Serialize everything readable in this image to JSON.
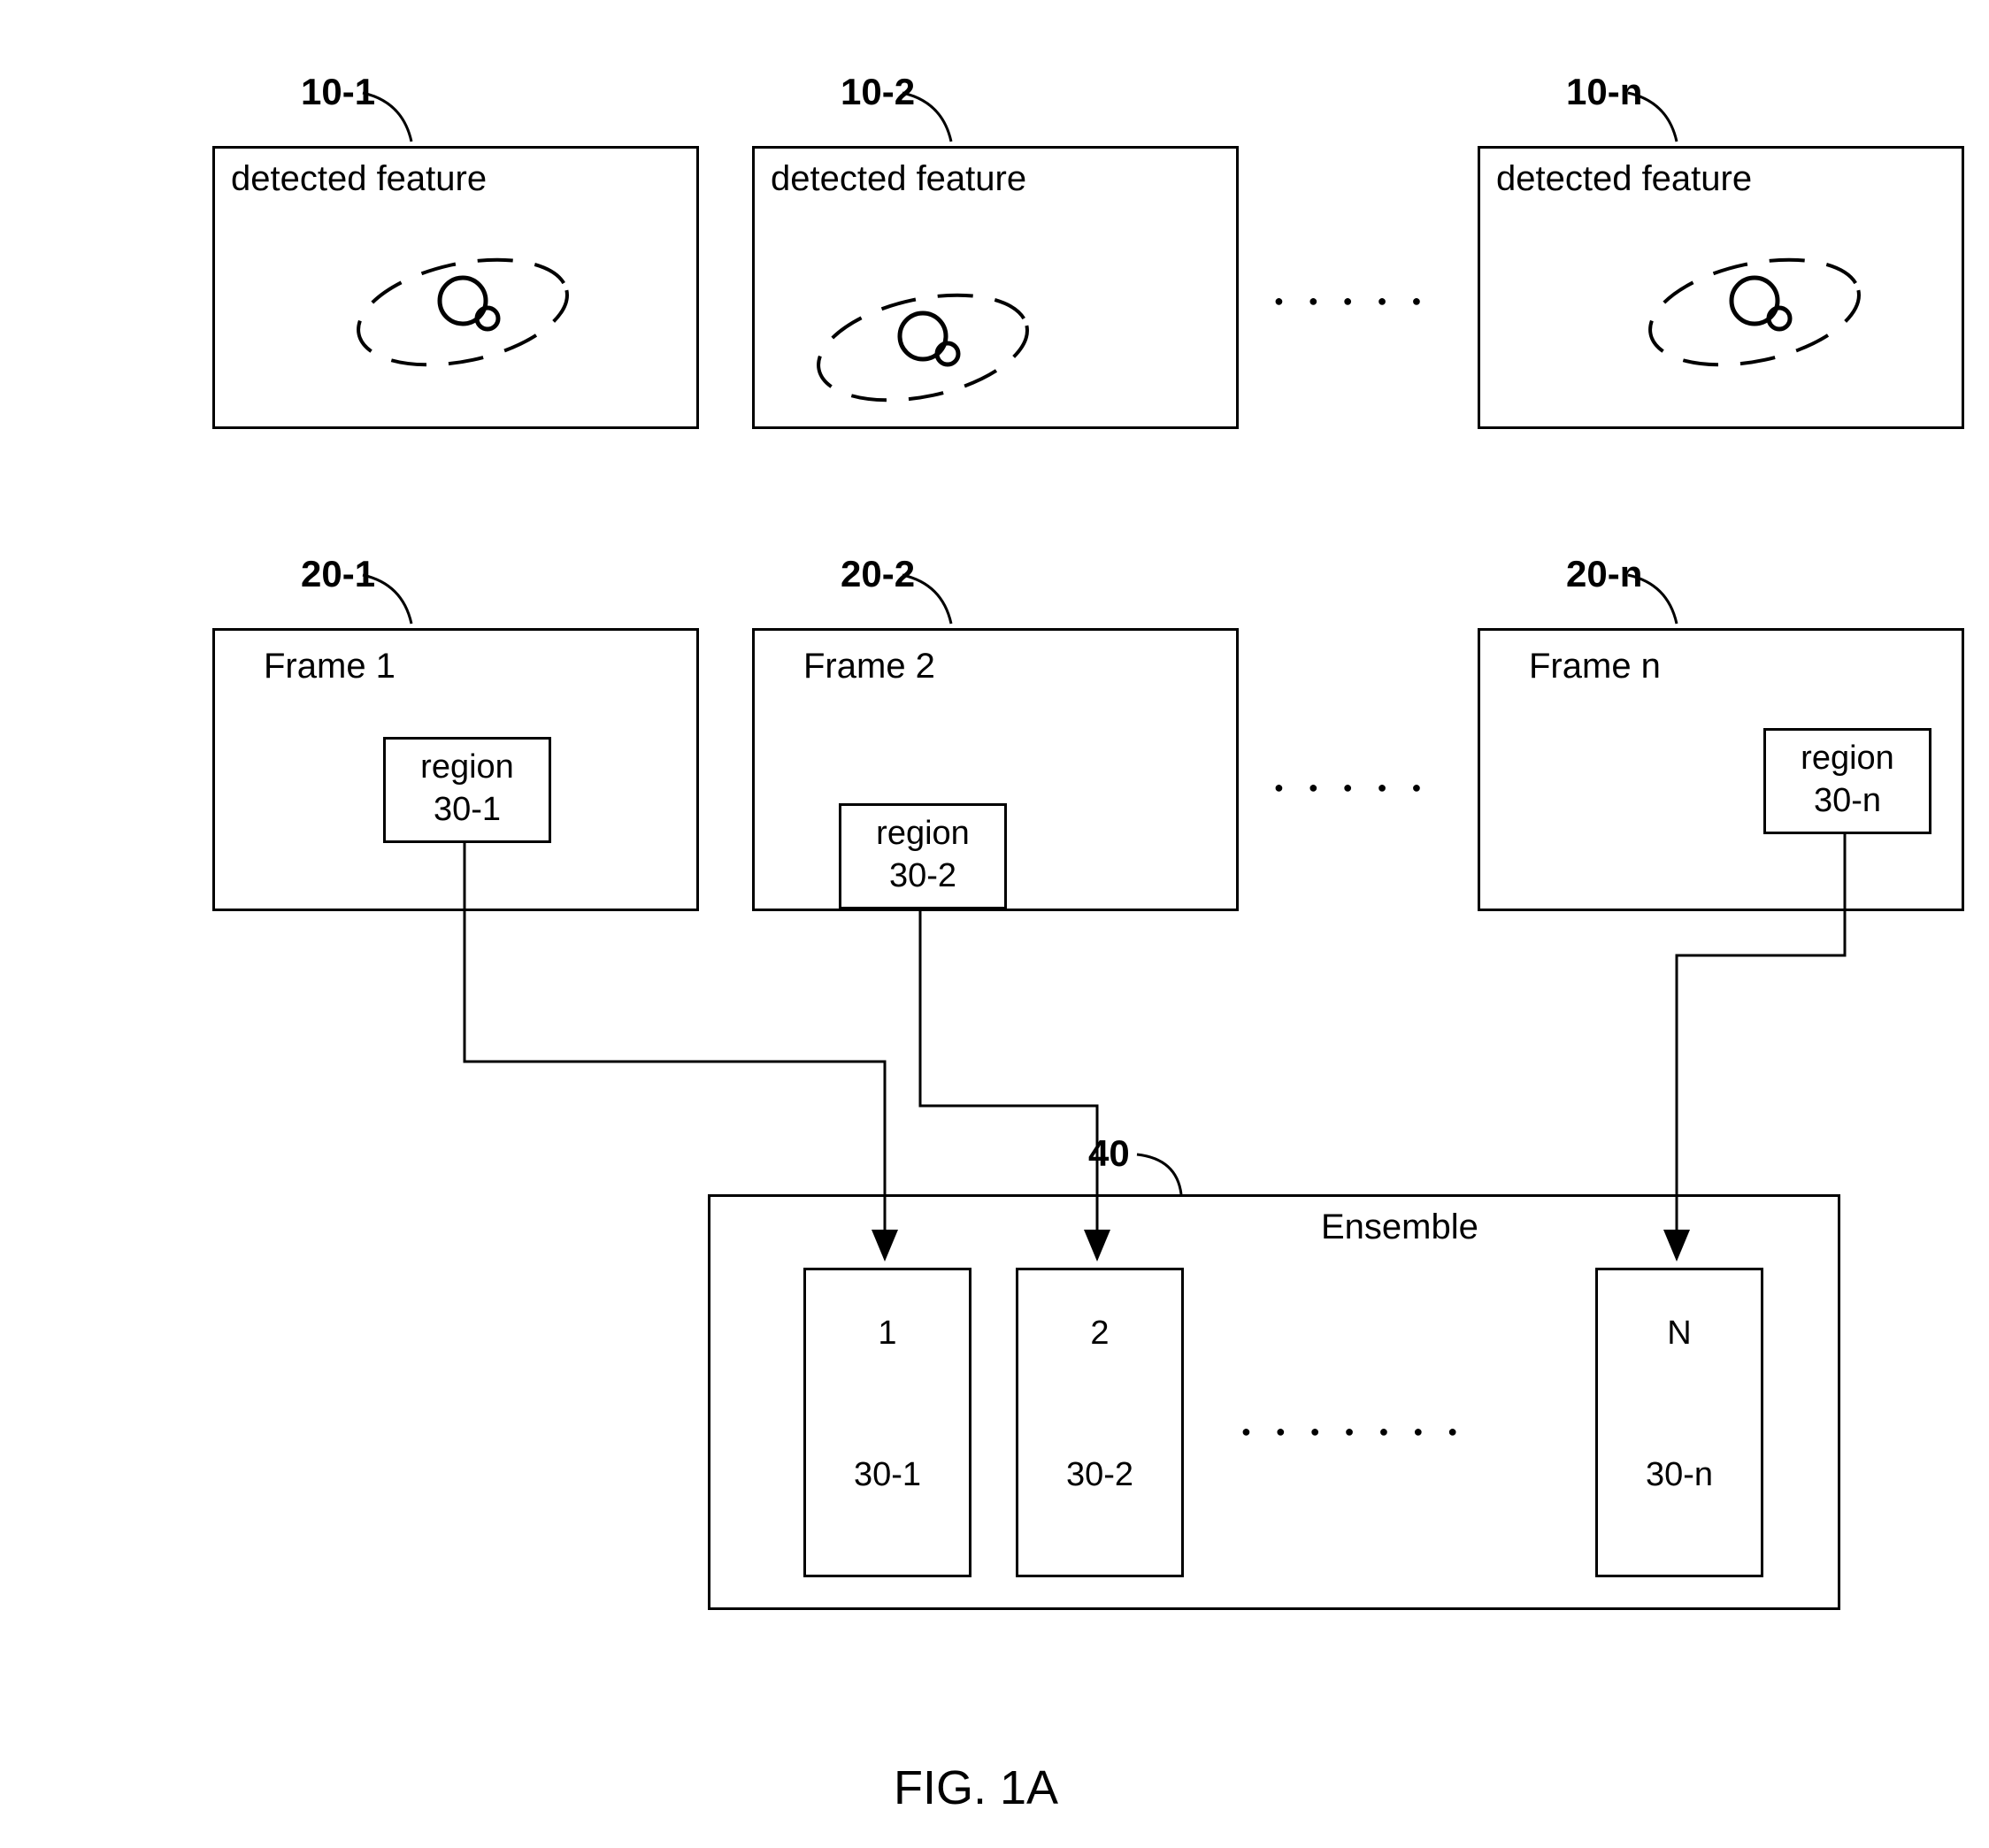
{
  "row1": {
    "ref1": "10-1",
    "ref2": "10-2",
    "refn": "10-n",
    "label": "detected feature"
  },
  "row2": {
    "ref1": "20-1",
    "ref2": "20-2",
    "refn": "20-n",
    "frame1": "Frame 1",
    "frame2": "Frame 2",
    "framen": "Frame n",
    "region": "region",
    "region1": "30-1",
    "region2": "30-2",
    "regionn": "30-n"
  },
  "ensemble": {
    "ref": "40",
    "label": "Ensemble",
    "slot1_top": "1",
    "slot1_bot": "30-1",
    "slot2_top": "2",
    "slot2_bot": "30-2",
    "slotn_top": "N",
    "slotn_bot": "30-n"
  },
  "figure": "FIG. 1A"
}
